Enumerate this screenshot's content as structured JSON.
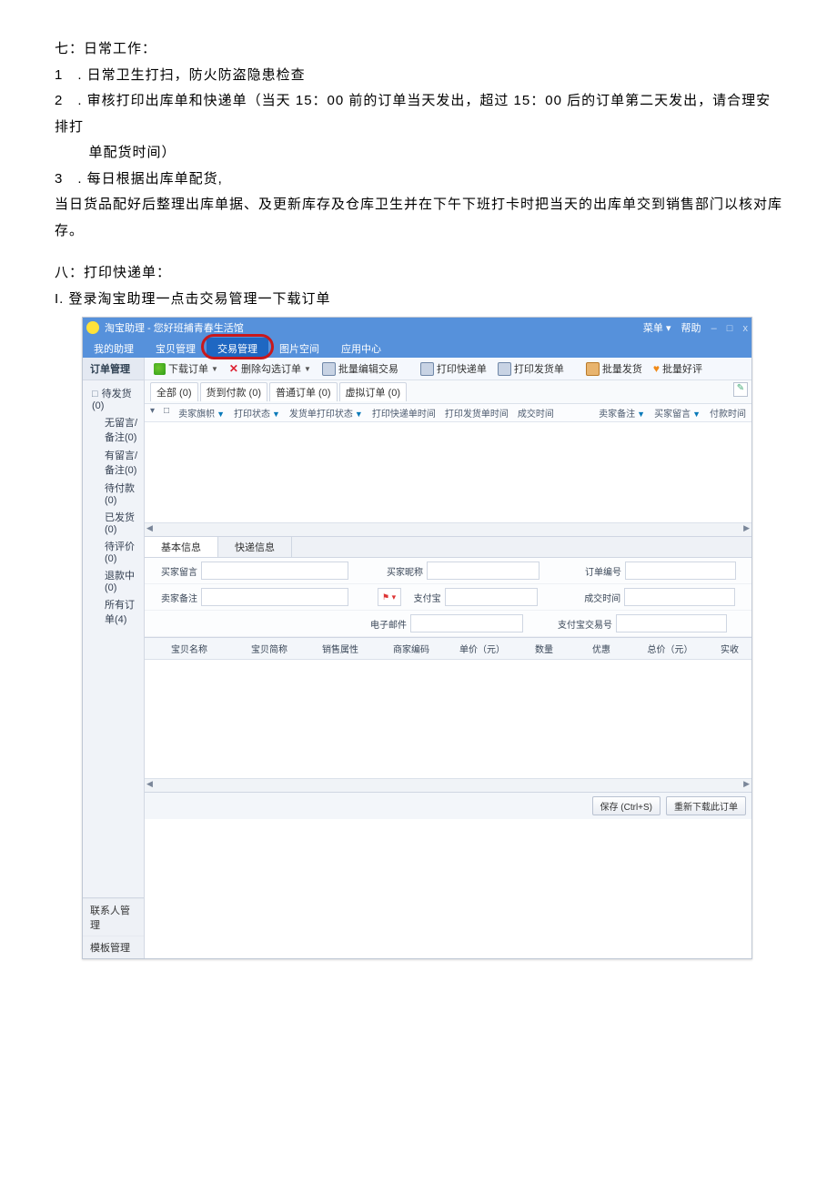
{
  "doc": {
    "s7_title": "七：日常工作：",
    "s7_li1": "1 . 日常卫生打扫，防火防盗隐患检查",
    "s7_li2": "2 . 审核打印出库单和快递单（当天 15：00 前的订单当天发出，超过 15：00 后的订单第二天发出，请合理安排打",
    "s7_li2b": "单配货时间）",
    "s7_li3": "3 . 每日根据出库单配货,",
    "s7_p1": "当日货品配好后整理出库单据、及更新库存及仓库卫生并在下午下班打卡时把当天的出库单交到销售部门以核对库",
    "s7_p2": "存。",
    "s8_title": "八：打印快递单：",
    "s8_li1": "I. 登录淘宝助理一点击交易管理一下载订单"
  },
  "app": {
    "title": "淘宝助理 - 您好班捕青春生活馆",
    "top_menu_label": "菜单",
    "top_help_label": "帮助",
    "minimize": "–",
    "maximize": "□",
    "close": "x",
    "menubar": [
      "我的助理",
      "宝贝管理",
      "交易管理",
      "图片空间",
      "应用中心"
    ],
    "sidebar": {
      "head": "订单管理",
      "root": "待发货(0)",
      "items": [
        "无留言/备注(0)",
        "有留言/备注(0)",
        "待付款(0)",
        "已发货(0)",
        "待评价(0)",
        "退款中(0)",
        "所有订单(4)"
      ],
      "foot1": "联系人管理",
      "foot2": "模板管理"
    },
    "toolbar": {
      "download": "下载订单",
      "delete": "删除勾选订单",
      "batch_edit": "批量编辑交易",
      "print_express": "打印快递单",
      "print_delivery": "打印发货单",
      "batch_ship": "批量发货",
      "batch_praise": "批量好评"
    },
    "sub_tabs": [
      "全部 (0)",
      "货到付款 (0)",
      "普通订单 (0)",
      "虚拟订单 (0)"
    ],
    "grid_header": {
      "chk": "□",
      "flag": "卖家旗帜",
      "print_status": "打印状态",
      "ship_print": "发货单打印状态",
      "express_time": "打印快递单时间",
      "ship_time": "打印发货单时间",
      "deal_time": "成交时间",
      "seller_note": "卖家备注",
      "buyer_msg": "买家留言",
      "pay_time": "付款时间"
    },
    "info_tabs": [
      "基本信息",
      "快递信息"
    ],
    "form": {
      "buyer_msg": "买家留言",
      "buyer_nick": "买家昵称",
      "order_no": "订单编号",
      "seller_note": "卖家备注",
      "alipay": "支付宝",
      "deal_time": "成交时间",
      "email": "电子邮件",
      "alipay_trade": "支付宝交易号"
    },
    "grid2": [
      "宝贝名称",
      "宝贝简称",
      "销售属性",
      "商家编码",
      "单价（元）",
      "数量",
      "优惠",
      "总价（元）",
      "实收"
    ],
    "bottom": {
      "save": "保存 (Ctrl+S)",
      "redownload": "重新下载此订单"
    }
  }
}
